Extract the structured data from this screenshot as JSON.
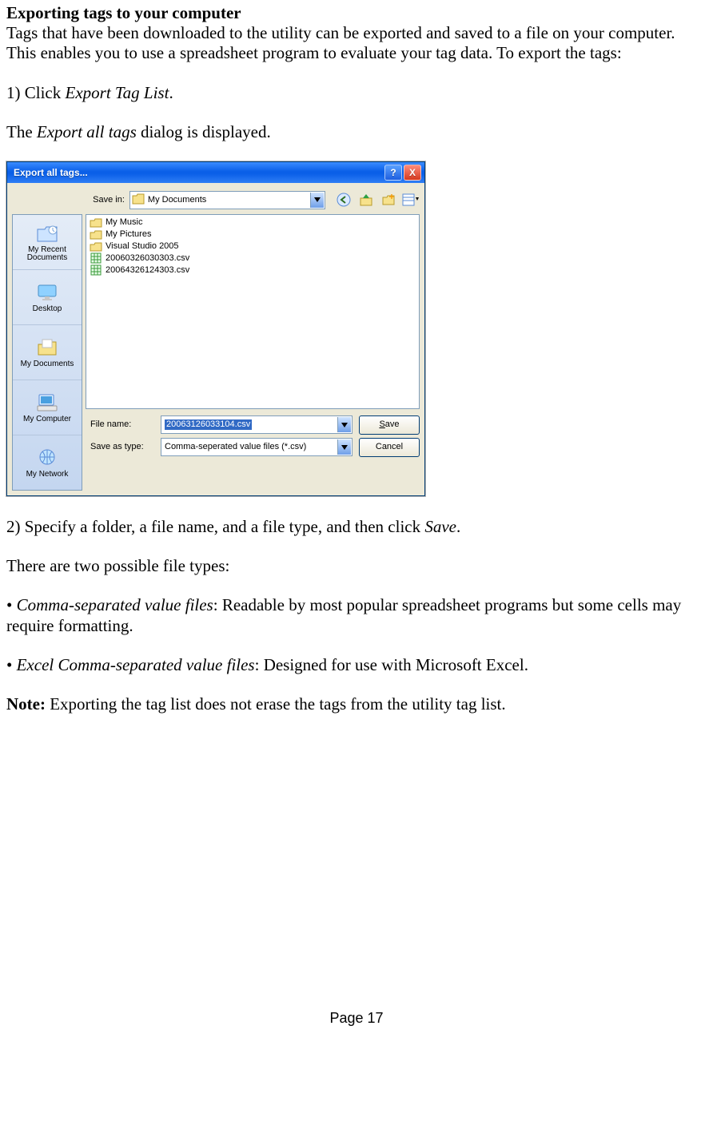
{
  "heading": "Exporting tags to your computer",
  "intro": "Tags that have been downloaded to the utility can be exported and saved to a file on your computer. This enables you to use a spreadsheet program to evaluate your tag data. To export the tags:",
  "step1_pre": "1) Click ",
  "step1_em": "Export Tag List",
  "step1_post": ".",
  "step1_line2_pre": "The ",
  "step1_line2_em": "Export all tags",
  "step1_line2_post": " dialog is displayed.",
  "dialog": {
    "title": "Export all tags...",
    "help": "?",
    "close": "X",
    "save_in_label": "Save in:",
    "save_in_value": "My Documents",
    "places": [
      "My Recent Documents",
      "Desktop",
      "My Documents",
      "My Computer",
      "My Network"
    ],
    "files": [
      {
        "type": "folder",
        "name": "My Music"
      },
      {
        "type": "folder",
        "name": "My Pictures"
      },
      {
        "type": "folder",
        "name": "Visual Studio 2005"
      },
      {
        "type": "csv",
        "name": "20060326030303.csv"
      },
      {
        "type": "csv",
        "name": "20064326124303.csv"
      }
    ],
    "filename_label": "File name:",
    "filename_value": "20063126033104.csv",
    "filetype_label": "Save as type:",
    "filetype_value": "Comma-seperated value files (*.csv)",
    "save_btn": "Save",
    "save_btn_u": "S",
    "cancel_btn": "Cancel"
  },
  "step2_pre": "2) Specify a folder, a file name, and a file type, and then click ",
  "step2_em": "Save",
  "step2_post": ".",
  "types_intro": "There are two possible file types:",
  "type_a_em": "Comma-separated value files",
  "type_a_desc": ": Readable by most popular spreadsheet programs but some cells may require formatting.",
  "type_b_em": "Excel Comma-separated value files",
  "type_b_desc": ": Designed for use with Microsoft Excel.",
  "note_bold": "Note:",
  "note_rest": " Exporting the tag list does not erase the tags from the utility tag list.",
  "page_label": "Page ",
  "page_number": "17"
}
